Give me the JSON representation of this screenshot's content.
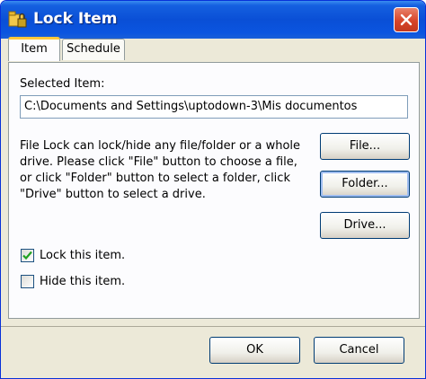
{
  "window": {
    "title": "Lock Item"
  },
  "tabs": [
    {
      "label": "Item"
    },
    {
      "label": "Schedule"
    }
  ],
  "item": {
    "selected_label": "Selected Item:",
    "selected_path": "C:\\Documents and Settings\\uptodown-3\\Mis documentos",
    "description_lines": [
      "File Lock can lock/hide any file/folder or a whole",
      "drive. Please click \"File\" button to choose a file,",
      "or click \"Folder\" button to select a folder, click",
      "\"Drive\" button to select a drive."
    ],
    "file_button": "File...",
    "folder_button": "Folder...",
    "drive_button": "Drive...",
    "lock_label": "Lock this item.",
    "lock_checked": true,
    "hide_label": "Hide this item.",
    "hide_checked": false
  },
  "footer": {
    "ok_label": "OK",
    "cancel_label": "Cancel"
  },
  "icons": {
    "title": "lock-folder-icon",
    "close": "close-icon",
    "check": "check-icon"
  },
  "colors": {
    "titlebar": "#0a4fd6",
    "close": "#d7452a",
    "check": "#21a121",
    "tab_highlight": "#ffc83c"
  }
}
